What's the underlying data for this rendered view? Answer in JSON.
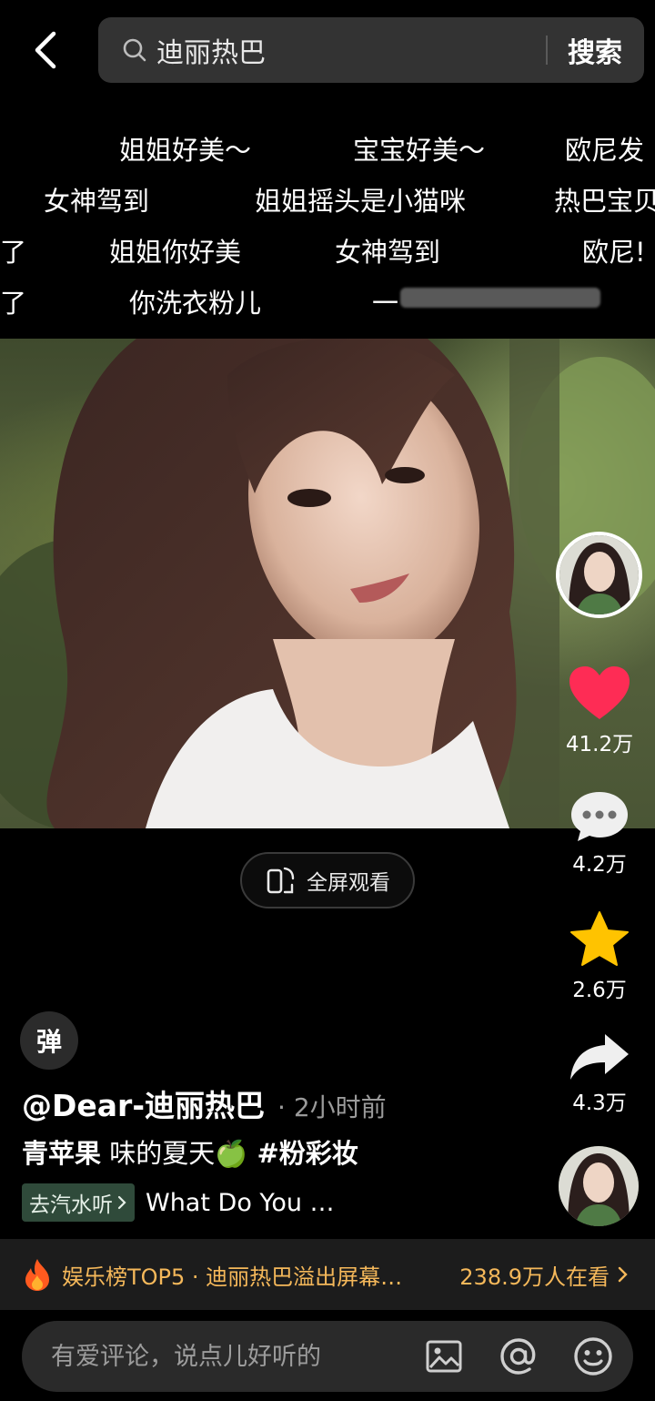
{
  "search": {
    "query": "迪丽热巴",
    "button_label": "搜索"
  },
  "danmaku": [
    "姐姐好美～",
    "宝宝好美～",
    "欧尼发",
    "女神驾到",
    "姐姐摇头是小猫咪",
    "热巴宝贝",
    "了",
    "姐姐你好美",
    "女神驾到",
    "欧尼!",
    "了",
    "你洗衣粉儿",
    "一"
  ],
  "video": {
    "fullscreen_label": "全屏观看"
  },
  "rail": {
    "like_count": "41.2万",
    "comment_count": "4.2万",
    "favorite_count": "2.6万",
    "share_count": "4.3万"
  },
  "post": {
    "danmu_toggle_label": "弹",
    "author": "@Dear-迪丽热巴",
    "time": "· 2小时前",
    "caption_bold": "青苹果",
    "caption_text": " 味的夏天",
    "caption_emoji": "🍏",
    "hashtag": " #粉彩妆",
    "music_tag": "去汽水听",
    "music_title": "What Do You …"
  },
  "hot": {
    "text": "娱乐榜TOP5 · 迪丽热巴溢出屏幕…",
    "viewers": "238.9万人在看"
  },
  "comment": {
    "placeholder": "有爱评论，说点儿好听的"
  },
  "colors": {
    "like": "#fe2c55",
    "favorite": "#ffc300",
    "hot_text": "#f5b85a"
  }
}
